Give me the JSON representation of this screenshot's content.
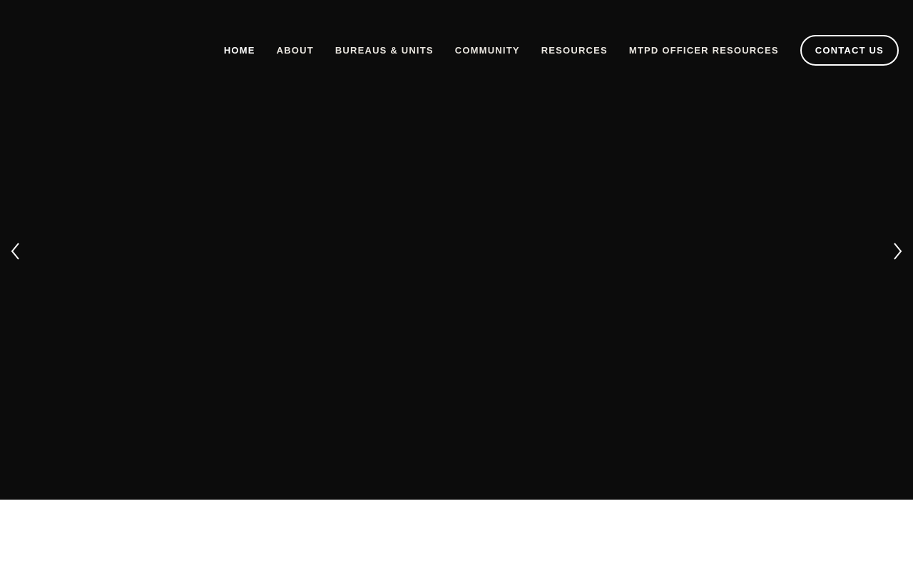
{
  "nav": {
    "items": [
      {
        "label": "HOME"
      },
      {
        "label": "ABOUT"
      },
      {
        "label": "BUREAUS & UNITS"
      },
      {
        "label": "COMMUNITY"
      },
      {
        "label": "RESOURCES"
      },
      {
        "label": "MTPD OFFICER RESOURCES"
      }
    ],
    "contact_label": "CONTACT US"
  },
  "slider": {
    "prev_icon": "chevron-left-icon",
    "next_icon": "chevron-right-icon",
    "background_color": "#0c0c0c"
  },
  "colors": {
    "nav_text": "#ffffff",
    "nav_text_secondary": "#e9e5df",
    "page_background": "#ffffff"
  }
}
